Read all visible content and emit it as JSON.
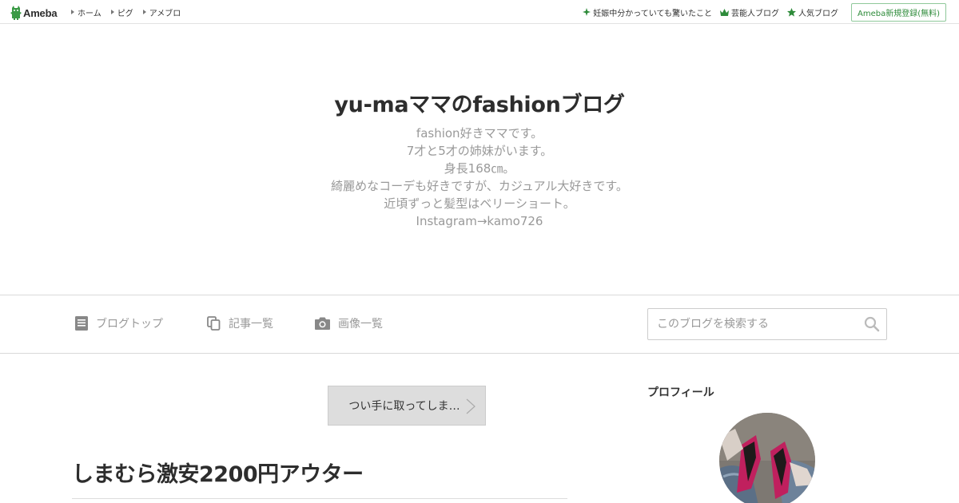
{
  "topbar": {
    "logo_text": "Ameba",
    "nav": [
      {
        "label": "ホーム"
      },
      {
        "label": "ピグ"
      },
      {
        "label": "アメブロ"
      }
    ],
    "right_links": [
      {
        "label": "妊娠中分かっていても驚いたこと",
        "icon": "sparkle-icon"
      },
      {
        "label": "芸能人ブログ",
        "icon": "crown-icon"
      },
      {
        "label": "人気ブログ",
        "icon": "star-icon"
      }
    ],
    "register_label": "Ameba新規登録(無料)"
  },
  "header": {
    "title": "yu-maママのfashionブログ",
    "description": [
      "fashion好きママです。",
      "7才と5才の姉妹がいます。",
      "身長168㎝。",
      "綺麗めなコーデも好きですが、カジュアル大好きです。",
      "近頃ずっと髪型はベリーショート。",
      "Instagram→kamo726"
    ]
  },
  "navbar": {
    "items": [
      {
        "label": "ブログトップ",
        "icon": "document-icon"
      },
      {
        "label": "記事一覧",
        "icon": "copy-icon"
      },
      {
        "label": "画像一覧",
        "icon": "camera-icon"
      }
    ],
    "search_placeholder": "このブログを検索する"
  },
  "main": {
    "pager_label": "つい手に取ってしま…",
    "entry_title": "しまむら激安2200円アウター"
  },
  "side": {
    "profile_heading": "プロフィール"
  },
  "colors": {
    "brand_green": "#2e8b3a",
    "muted_text": "#999999",
    "border": "#d9d9d9"
  }
}
